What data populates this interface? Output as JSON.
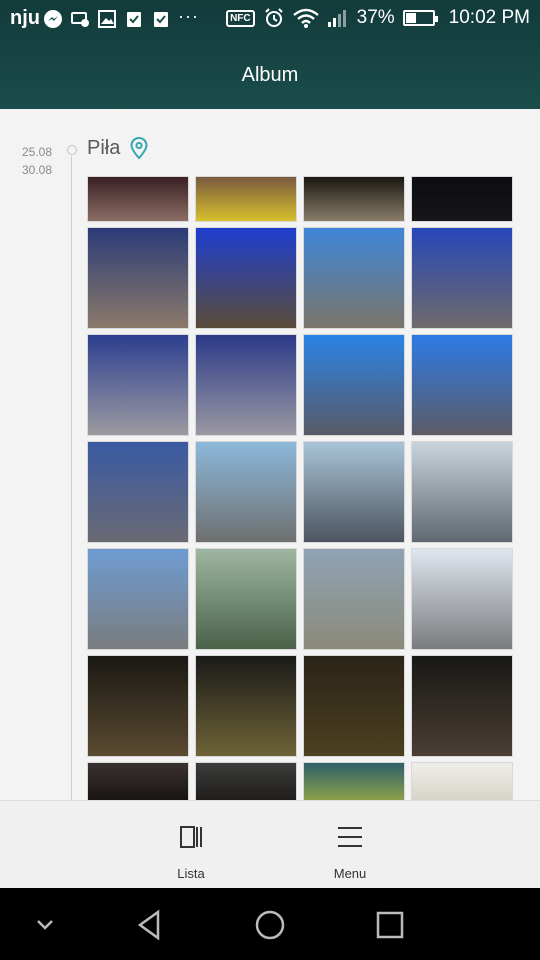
{
  "status": {
    "carrier": "nju",
    "dots": "···",
    "nfc": "NFC",
    "battery_pct": "37%",
    "battery_level": 0.37,
    "time": "10:02 PM"
  },
  "header": {
    "title": "Album"
  },
  "section": {
    "date_start": "25.08",
    "date_end": "30.08",
    "place": "Piła",
    "place_icon": "location-pin-icon",
    "accent_color": "#34a7b1"
  },
  "photos": [
    {
      "top": "#3a1f24",
      "bottom": "#8b6e64"
    },
    {
      "top": "#7a5a40",
      "bottom": "#d6c02c"
    },
    {
      "top": "#1a1812",
      "bottom": "#8a7e6a"
    },
    {
      "top": "#0c0d10",
      "bottom": "#16161a"
    },
    {
      "top": "#2b3b78",
      "bottom": "#8b7a6a"
    },
    {
      "top": "#1e3ed0",
      "bottom": "#5a4b38"
    },
    {
      "top": "#3f86d8",
      "bottom": "#7a756a"
    },
    {
      "top": "#2747b9",
      "bottom": "#6f6a6a"
    },
    {
      "top": "#2c3f90",
      "bottom": "#9c9aa0"
    },
    {
      "top": "#2b3a88",
      "bottom": "#9a98a2"
    },
    {
      "top": "#2a83e6",
      "bottom": "#595a66"
    },
    {
      "top": "#2d7ae6",
      "bottom": "#5b5c66"
    },
    {
      "top": "#3a5aa3",
      "bottom": "#6a6a74"
    },
    {
      "top": "#8cb8da",
      "bottom": "#6f7070"
    },
    {
      "top": "#a9c4d8",
      "bottom": "#4c5560"
    },
    {
      "top": "#c9d4dc",
      "bottom": "#606872"
    },
    {
      "top": "#6e9cd2",
      "bottom": "#7a7c7e"
    },
    {
      "top": "#9fb7a2",
      "bottom": "#496248"
    },
    {
      "top": "#8fa3b4",
      "bottom": "#8b8a7a"
    },
    {
      "top": "#dfe6ee",
      "bottom": "#7a7c7e"
    },
    {
      "top": "#1a1814",
      "bottom": "#5a4a30"
    },
    {
      "top": "#1a1a18",
      "bottom": "#6e6338"
    },
    {
      "top": "#2a2418",
      "bottom": "#4c4020"
    },
    {
      "top": "#181816",
      "bottom": "#4a3e34"
    },
    {
      "top": "#3a3230",
      "bottom": "#181412"
    },
    {
      "top": "#3b3e3c",
      "bottom": "#201c1a"
    },
    {
      "top": "#2f5f6a",
      "bottom": "#8ea24a"
    },
    {
      "top": "#efeeea",
      "bottom": "#d7d3c8"
    }
  ],
  "actions": [
    {
      "label": "Lista",
      "icon": "list-view-icon"
    },
    {
      "label": "Menu",
      "icon": "menu-icon"
    }
  ],
  "nav": {
    "collapse_icon": "chevron-down-icon",
    "back_icon": "back-triangle-icon",
    "home_icon": "home-circle-icon",
    "recents_icon": "recents-square-icon"
  }
}
